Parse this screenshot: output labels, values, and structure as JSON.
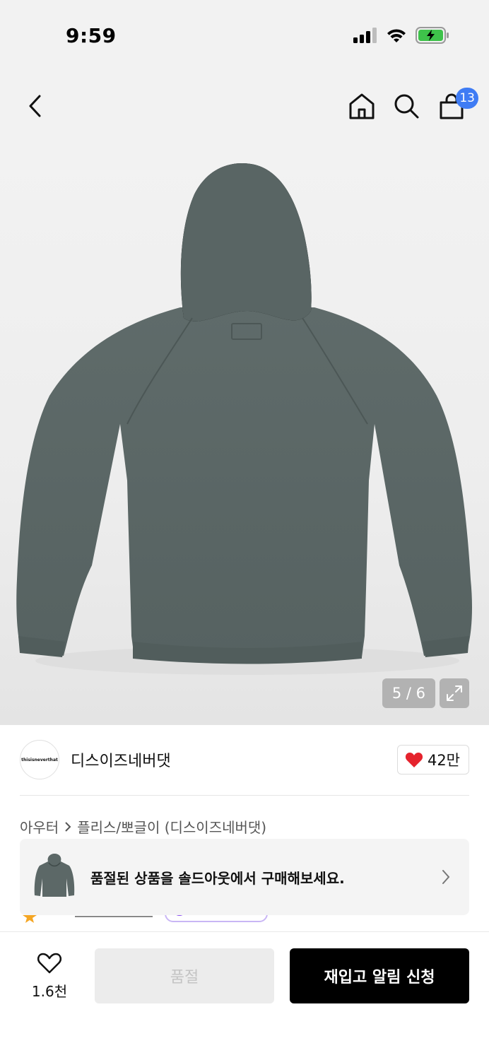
{
  "status_bar": {
    "time": "9:59"
  },
  "header": {
    "cart_count": "13"
  },
  "gallery": {
    "pager": "5 / 6"
  },
  "brand": {
    "name": "디스이즈네버댓",
    "logo_text": "thisisneverthat",
    "like_count": "42만"
  },
  "breadcrumb": {
    "category": "아우터",
    "subcategory": "플리스/뽀글이 (디스이즈네버댓)"
  },
  "sold_banner": {
    "text": "품절된 상품을 솔드아웃에서 구매해보세요."
  },
  "bottom_bar": {
    "wish_count": "1.6천",
    "soldout_label": "품절",
    "restock_label": "재입고 알림 신청"
  },
  "colors": {
    "accent_blue": "#3f7cf4",
    "heart_red": "#e5232d",
    "hoodie_gray": "#5c6867"
  },
  "icons": [
    "back-icon",
    "home-icon",
    "search-icon",
    "cart-icon",
    "expand-icon",
    "heart-icon",
    "chevron-right-icon"
  ]
}
